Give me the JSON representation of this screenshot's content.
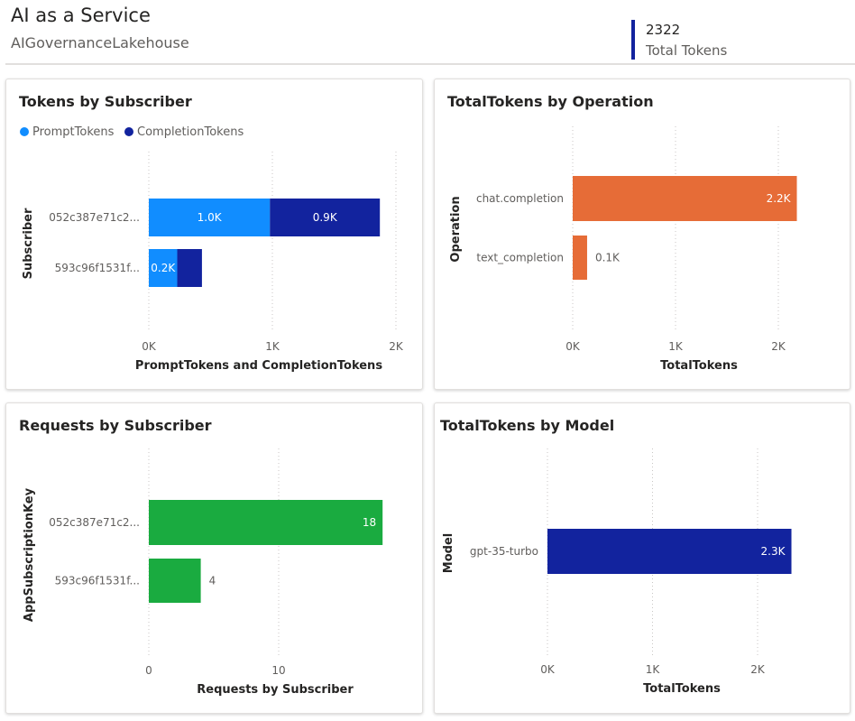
{
  "header": {
    "title": "AI as a Service",
    "subtitle": "AIGovernanceLakehouse"
  },
  "kpi": {
    "value": "2322",
    "label": "Total Tokens",
    "accent_color": "#12239e"
  },
  "chart_data": [
    {
      "type": "bar",
      "orientation": "horizontal",
      "stacked": true,
      "title": "Tokens by Subscriber",
      "xlabel": "PromptTokens and CompletionTokens",
      "ylabel": "Subscriber",
      "categories": [
        "052c387e71c2...",
        "593c96f1531f..."
      ],
      "series": [
        {
          "name": "PromptTokens",
          "color": "#118dff",
          "values": [
            980,
            230
          ],
          "labels": [
            "1.0K",
            "0.2K"
          ]
        },
        {
          "name": "CompletionTokens",
          "color": "#12239e",
          "values": [
            890,
            200
          ],
          "labels": [
            "0.9K",
            ""
          ]
        }
      ],
      "xlim": [
        0,
        2000
      ],
      "xticks": [
        "0K",
        "1K",
        "2K"
      ],
      "legend": "top-left",
      "grid": true
    },
    {
      "type": "bar",
      "orientation": "horizontal",
      "title": "TotalTokens by Operation",
      "xlabel": "TotalTokens",
      "ylabel": "Operation",
      "categories": [
        "chat.completion",
        "text_completion"
      ],
      "series": [
        {
          "color": "#e66c37",
          "values": [
            2180,
            140
          ],
          "labels": [
            "2.2K",
            "0.1K"
          ]
        }
      ],
      "xlim": [
        0,
        2000
      ],
      "xticks": [
        "0K",
        "1K",
        "2K"
      ],
      "grid": true
    },
    {
      "type": "bar",
      "orientation": "horizontal",
      "title": "Requests by Subscriber",
      "xlabel": "Requests by Subscriber",
      "ylabel": "AppSubscriptionKey",
      "categories": [
        "052c387e71c2...",
        "593c96f1531f..."
      ],
      "series": [
        {
          "color": "#1aab40",
          "values": [
            18,
            4
          ],
          "labels": [
            "18",
            "4"
          ]
        }
      ],
      "xlim": [
        0,
        10
      ],
      "xticks": [
        "0",
        "10"
      ],
      "grid": true
    },
    {
      "type": "bar",
      "orientation": "horizontal",
      "title": "TotalTokens by Model",
      "xlabel": "TotalTokens",
      "ylabel": "Model",
      "categories": [
        "gpt-35-turbo"
      ],
      "series": [
        {
          "color": "#12239e",
          "values": [
            2322
          ],
          "labels": [
            "2.3K"
          ]
        }
      ],
      "xlim": [
        0,
        2000
      ],
      "xticks": [
        "0K",
        "1K",
        "2K"
      ],
      "grid": true
    }
  ]
}
